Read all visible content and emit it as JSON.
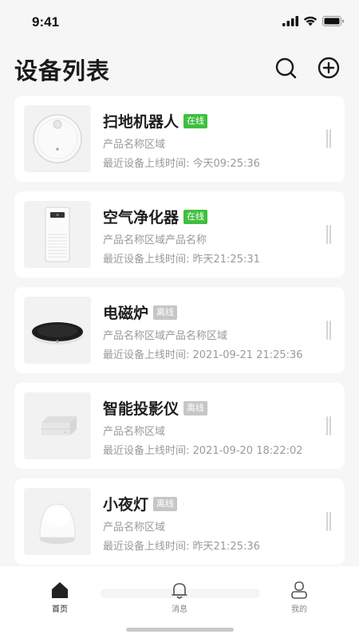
{
  "status": {
    "time": "9:41"
  },
  "header": {
    "title": "设备列表"
  },
  "devices": [
    {
      "name": "扫地机器人",
      "status": "在线",
      "online": true,
      "region": "产品名称区域",
      "last_online": "最近设备上线时间: 今天09:25:36",
      "image": "robot-vacuum"
    },
    {
      "name": "空气净化器",
      "status": "在线",
      "online": true,
      "region": "产品名称区域产品名称",
      "last_online": "最近设备上线时间: 昨天21:25:31",
      "image": "air-purifier"
    },
    {
      "name": "电磁炉",
      "status": "离线",
      "online": false,
      "region": "产品名称区域产品名称区域",
      "last_online": "最近设备上线时间: 2021-09-21 21:25:36",
      "image": "induction-cooker"
    },
    {
      "name": "智能投影仪",
      "status": "离线",
      "online": false,
      "region": "产品名称区域",
      "last_online": "最近设备上线时间: 2021-09-20 18:22:02",
      "image": "projector"
    },
    {
      "name": "小夜灯",
      "status": "离线",
      "online": false,
      "region": "产品名称区域",
      "last_online": "最近设备上线时间: 昨天21:25:36",
      "image": "night-light"
    }
  ],
  "tabs": [
    {
      "label": "首页",
      "icon": "home-icon",
      "active": true
    },
    {
      "label": "消息",
      "icon": "bell-icon",
      "active": false
    },
    {
      "label": "我的",
      "icon": "user-icon",
      "active": false
    }
  ],
  "colors": {
    "online": "#3fbf3f",
    "offline": "#c6c6c6",
    "background": "#f6f6f6"
  }
}
